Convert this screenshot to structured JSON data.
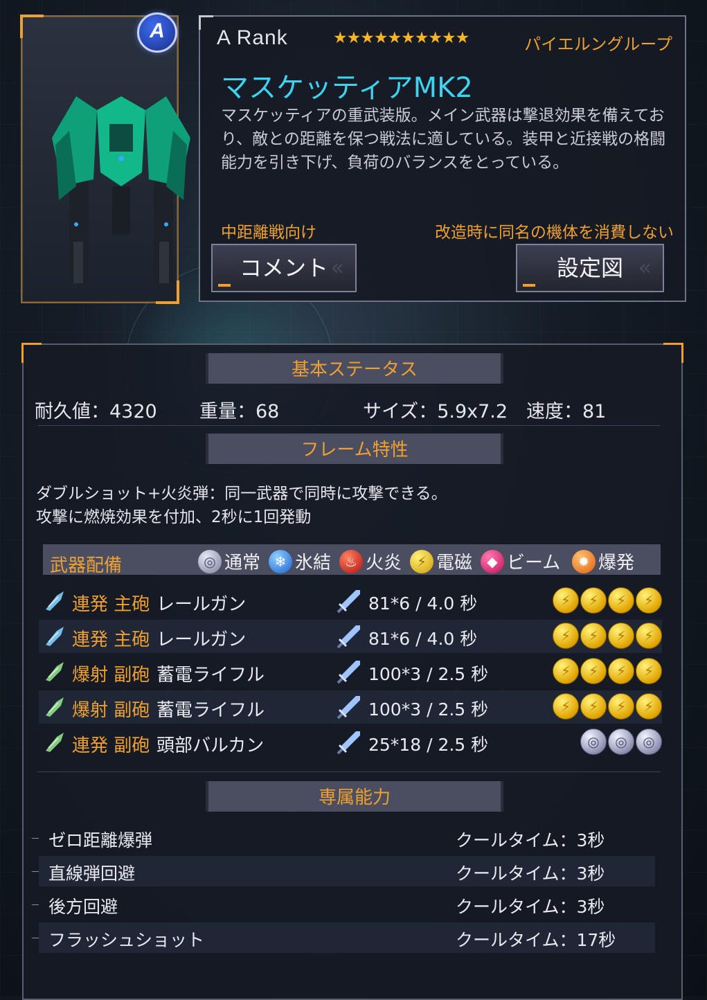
{
  "unit": {
    "rank_badge": "A",
    "rank_text": "A  Rank",
    "stars": "★★★★★★★★★★",
    "maker": "パイエルングループ",
    "name": "マスケッティアMK2",
    "description": "マスケッティアの重武装版。メイン武器は撃退効果を備えており、敵との距離を保つ戦法に適している。装甲と近接戦の格闘能力を引き下げ、負荷のバランスをとっている。",
    "tag_left": "中距離戦向け",
    "tag_right": "改造時に同名の機体を消費しない"
  },
  "buttons": {
    "comment": "コメント",
    "blueprint": "設定図"
  },
  "basic_status": {
    "header": "基本ステータス",
    "durability": "耐久値：4320",
    "weight": "重量：68",
    "size": "サイズ：5.9x7.2",
    "speed": "速度：81"
  },
  "frame": {
    "header": "フレーム特性",
    "line1": "ダブルショット+火炎弾：同一武器で同時に攻撃できる。",
    "line2": "攻撃に燃焼効果を付加、2秒に1回発動"
  },
  "weapons": {
    "header": "武器配備",
    "elements": [
      {
        "label": "通常",
        "icon": "normal-element-icon"
      },
      {
        "label": "氷結",
        "icon": "ice-element-icon"
      },
      {
        "label": "火炎",
        "icon": "fire-element-icon"
      },
      {
        "label": "電磁",
        "icon": "electric-element-icon"
      },
      {
        "label": "ビーム",
        "icon": "beam-element-icon"
      },
      {
        "label": "爆発",
        "icon": "blast-element-icon"
      }
    ],
    "rows": [
      {
        "type": "連発 主砲",
        "name": "レールガン",
        "damage": "81*6 / 4.0 秒",
        "element": "electric",
        "count": 4
      },
      {
        "type": "連発 主砲",
        "name": "レールガン",
        "damage": "81*6 / 4.0 秒",
        "element": "electric",
        "count": 4
      },
      {
        "type": "爆射 副砲",
        "name": "蓄電ライフル",
        "damage": "100*3 / 2.5 秒",
        "element": "electric",
        "count": 4
      },
      {
        "type": "爆射 副砲",
        "name": "蓄電ライフル",
        "damage": "100*3 / 2.5 秒",
        "element": "electric",
        "count": 4
      },
      {
        "type": "連発 副砲",
        "name": "頭部バルカン",
        "damage": "25*18 / 2.5 秒",
        "element": "normal",
        "count": 3
      }
    ]
  },
  "abilities": {
    "header": "専属能力",
    "rows": [
      {
        "name": "ゼロ距離爆弾",
        "cooldown": "クールタイム：3秒"
      },
      {
        "name": "直線弾回避",
        "cooldown": "クールタイム：3秒"
      },
      {
        "name": "後方回避",
        "cooldown": "クールタイム：3秒"
      },
      {
        "name": "フラッシュショット",
        "cooldown": "クールタイム：17秒"
      }
    ]
  },
  "colors": {
    "accent": "#f0a030",
    "name": "#3ed4f0",
    "electric": "#e0a400"
  }
}
